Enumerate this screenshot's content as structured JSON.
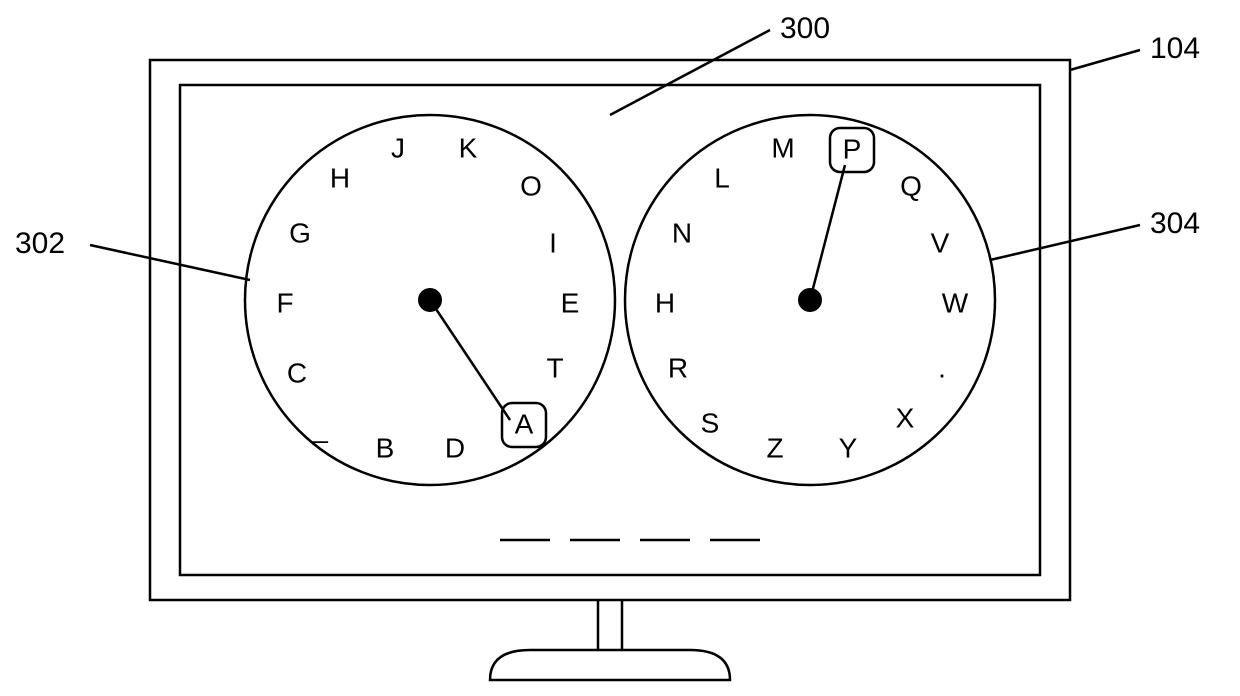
{
  "callouts": {
    "c300": "300",
    "c104": "104",
    "c302": "302",
    "c304": "304"
  },
  "dial_left": {
    "letters_cw_from_top": [
      "J",
      "K",
      "O",
      "I",
      "E",
      "T",
      "A",
      "D",
      "B",
      "_",
      "C",
      "F",
      "G",
      "H"
    ],
    "selected_letter": "A"
  },
  "dial_right": {
    "letters_cw_from_top": [
      "M",
      "P",
      "Q",
      "V",
      "W",
      ".",
      "X",
      "Y",
      "Z",
      "S",
      "R",
      "H",
      "N",
      "L"
    ],
    "selected_letter": "P"
  },
  "blanks_count": 4
}
